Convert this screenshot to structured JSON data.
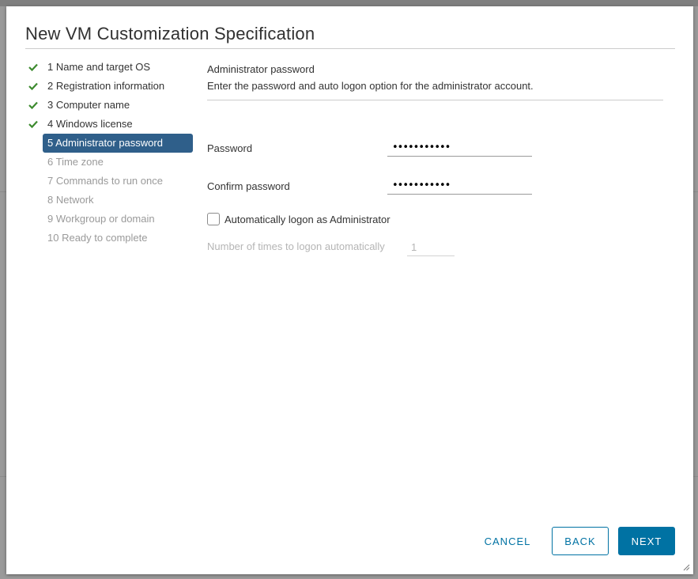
{
  "dialog": {
    "title": "New VM Customization Specification"
  },
  "steps": [
    {
      "label": "1 Name and target OS",
      "status": "completed"
    },
    {
      "label": "2 Registration information",
      "status": "completed"
    },
    {
      "label": "3 Computer name",
      "status": "completed"
    },
    {
      "label": "4 Windows license",
      "status": "completed"
    },
    {
      "label": "5 Administrator password",
      "status": "active"
    },
    {
      "label": "6 Time zone",
      "status": "pending"
    },
    {
      "label": "7 Commands to run once",
      "status": "pending"
    },
    {
      "label": "8 Network",
      "status": "pending"
    },
    {
      "label": "9 Workgroup or domain",
      "status": "pending"
    },
    {
      "label": "10 Ready to complete",
      "status": "pending"
    }
  ],
  "content": {
    "section_title": "Administrator password",
    "section_desc": "Enter the password and auto logon option for the administrator account.",
    "password_label": "Password",
    "password_value": "•••••••••••",
    "confirm_label": "Confirm password",
    "confirm_value": "•••••••••••",
    "auto_logon_label": "Automatically logon as Administrator",
    "auto_logon_checked": false,
    "logon_times_label": "Number of times to logon automatically",
    "logon_times_value": "1"
  },
  "footer": {
    "cancel_label": "CANCEL",
    "back_label": "BACK",
    "next_label": "NEXT"
  },
  "colors": {
    "accent": "#0072a3",
    "active_step_bg": "#2f5f8a",
    "check_green": "#3c8a2e"
  }
}
